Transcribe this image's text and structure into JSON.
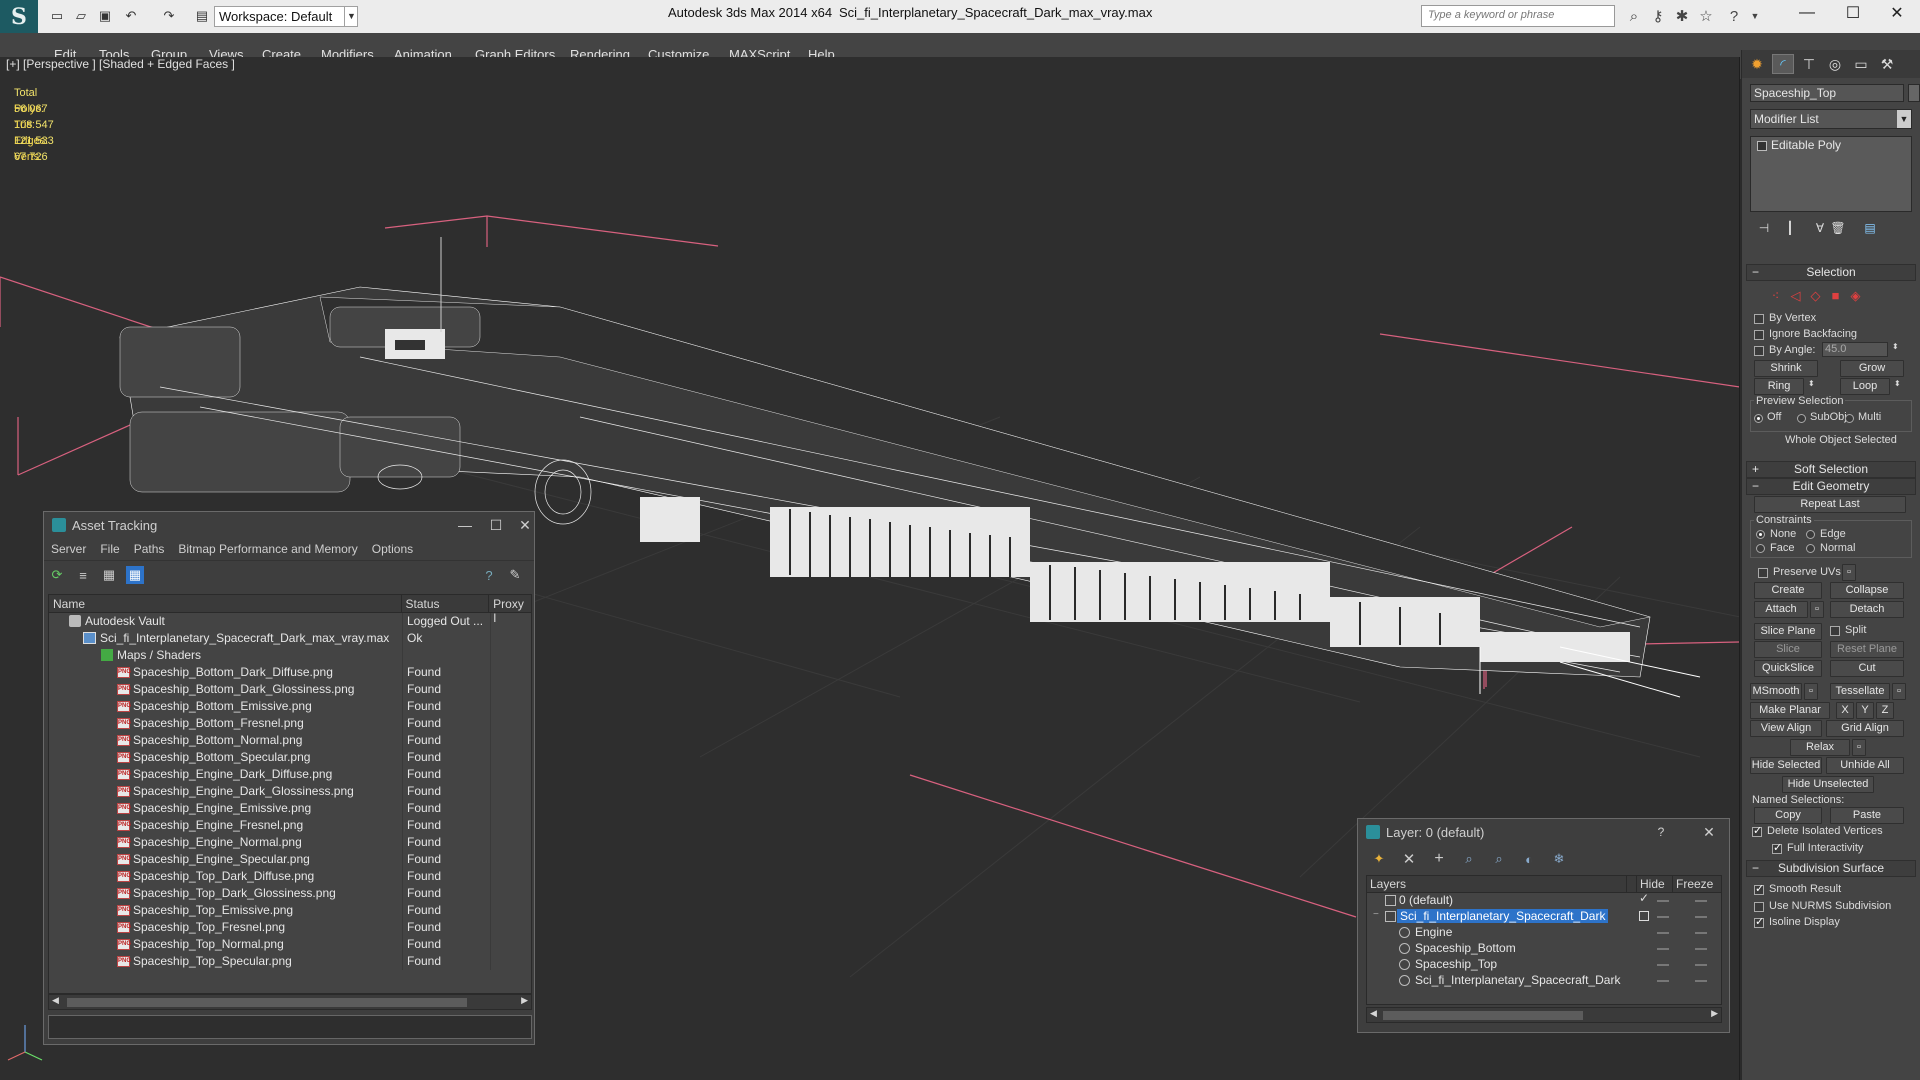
{
  "titlebar": {
    "app_title": "Autodesk 3ds Max  2014 x64",
    "file_name": "Sci_fi_Interplanetary_Spacecraft_Dark_max_vray.max",
    "workspace": "Workspace: Default",
    "search_placeholder": "Type a keyword or phrase"
  },
  "menubar": {
    "items": [
      "Edit",
      "Tools",
      "Group",
      "Views",
      "Create",
      "Modifiers",
      "Animation",
      "Graph Editors",
      "Rendering",
      "Customize",
      "MAXScript",
      "Help"
    ]
  },
  "viewport": {
    "label": "[+] [Perspective ] [Shaded + Edged Faces ]",
    "stats": {
      "header": "Total",
      "rows": [
        {
          "label": "Polys:",
          "value": "56 067"
        },
        {
          "label": "Tris:",
          "value": "108 547"
        },
        {
          "label": "Edges:",
          "value": "121 533"
        },
        {
          "label": "Verts:",
          "value": "67 726"
        }
      ]
    }
  },
  "asset_tracking": {
    "title": "Asset Tracking",
    "menus": [
      "Server",
      "File",
      "Paths",
      "Bitmap Performance and Memory",
      "Options"
    ],
    "columns": [
      "Name",
      "Status",
      "Proxy I"
    ],
    "vault_row": {
      "name": "Autodesk Vault",
      "status": "Logged Out ..."
    },
    "max_row": {
      "name": "Sci_fi_Interplanetary_Spacecraft_Dark_max_vray.max",
      "status": "Ok"
    },
    "maps_row": {
      "name": "Maps / Shaders",
      "status": ""
    },
    "files": [
      {
        "name": "Spaceship_Bottom_Dark_Diffuse.png",
        "status": "Found"
      },
      {
        "name": "Spaceship_Bottom_Dark_Glossiness.png",
        "status": "Found"
      },
      {
        "name": "Spaceship_Bottom_Emissive.png",
        "status": "Found"
      },
      {
        "name": "Spaceship_Bottom_Fresnel.png",
        "status": "Found"
      },
      {
        "name": "Spaceship_Bottom_Normal.png",
        "status": "Found"
      },
      {
        "name": "Spaceship_Bottom_Specular.png",
        "status": "Found"
      },
      {
        "name": "Spaceship_Engine_Dark_Diffuse.png",
        "status": "Found"
      },
      {
        "name": "Spaceship_Engine_Dark_Glossiness.png",
        "status": "Found"
      },
      {
        "name": "Spaceship_Engine_Emissive.png",
        "status": "Found"
      },
      {
        "name": "Spaceship_Engine_Fresnel.png",
        "status": "Found"
      },
      {
        "name": "Spaceship_Engine_Normal.png",
        "status": "Found"
      },
      {
        "name": "Spaceship_Engine_Specular.png",
        "status": "Found"
      },
      {
        "name": "Spaceship_Top_Dark_Diffuse.png",
        "status": "Found"
      },
      {
        "name": "Spaceship_Top_Dark_Glossiness.png",
        "status": "Found"
      },
      {
        "name": "Spaceship_Top_Emissive.png",
        "status": "Found"
      },
      {
        "name": "Spaceship_Top_Fresnel.png",
        "status": "Found"
      },
      {
        "name": "Spaceship_Top_Normal.png",
        "status": "Found"
      },
      {
        "name": "Spaceship_Top_Specular.png",
        "status": "Found"
      }
    ]
  },
  "layer_dialog": {
    "title": "Layer: 0 (default)",
    "help": "?",
    "columns": [
      "Layers",
      "Hide",
      "Freeze"
    ],
    "rows": [
      {
        "name": "0 (default)",
        "level": 0
      },
      {
        "name": "Sci_fi_Interplanetary_Spacecraft_Dark",
        "level": 0
      },
      {
        "name": "Engine",
        "level": 1
      },
      {
        "name": "Spaceship_Bottom",
        "level": 1
      },
      {
        "name": "Spaceship_Top",
        "level": 1
      },
      {
        "name": "Sci_fi_Interplanetary_Spacecraft_Dark",
        "level": 1
      }
    ]
  },
  "command_panel": {
    "object_name": "Spaceship_Top",
    "modifier_list": "Modifier List",
    "stack_item": "Editable Poly",
    "selection": {
      "title": "Selection",
      "by_vertex": "By Vertex",
      "ignore_backfacing": "Ignore Backfacing",
      "by_angle": "By Angle:",
      "angle_value": "45.0",
      "shrink": "Shrink",
      "grow": "Grow",
      "ring": "Ring",
      "loop": "Loop",
      "preview_title": "Preview Selection",
      "preview_off": "Off",
      "preview_subobj": "SubObj",
      "preview_multi": "Multi",
      "status": "Whole Object Selected"
    },
    "soft_selection": "Soft Selection",
    "edit_geometry": {
      "title": "Edit Geometry",
      "repeat_last": "Repeat Last",
      "constraints": "Constraints",
      "none": "None",
      "edge": "Edge",
      "face": "Face",
      "normal": "Normal",
      "preserve_uvs": "Preserve UVs",
      "create": "Create",
      "collapse": "Collapse",
      "attach": "Attach",
      "detach": "Detach",
      "slice_plane": "Slice Plane",
      "split": "Split",
      "slice": "Slice",
      "reset_plane": "Reset Plane",
      "quickslice": "QuickSlice",
      "cut": "Cut",
      "msmooth": "MSmooth",
      "tessellate": "Tessellate",
      "make_planar": "Make Planar",
      "x": "X",
      "y": "Y",
      "z": "Z",
      "view_align": "View Align",
      "grid_align": "Grid Align",
      "relax": "Relax",
      "hide_selected": "Hide Selected",
      "unhide_all": "Unhide All",
      "hide_unselected": "Hide Unselected",
      "named_selections": "Named Selections:",
      "copy": "Copy",
      "paste": "Paste",
      "delete_isolated": "Delete Isolated Vertices",
      "full_interactivity": "Full Interactivity"
    },
    "subdivision": {
      "title": "Subdivision Surface",
      "smooth_result": "Smooth Result",
      "use_nurms": "Use NURMS Subdivision",
      "isoline": "Isoline Display"
    }
  },
  "colors": {
    "accent": "#1d5a62",
    "selection_blue": "#2d73c9",
    "stats_yellow": "#f2e36b",
    "bbox_pink": "#d8617f"
  }
}
